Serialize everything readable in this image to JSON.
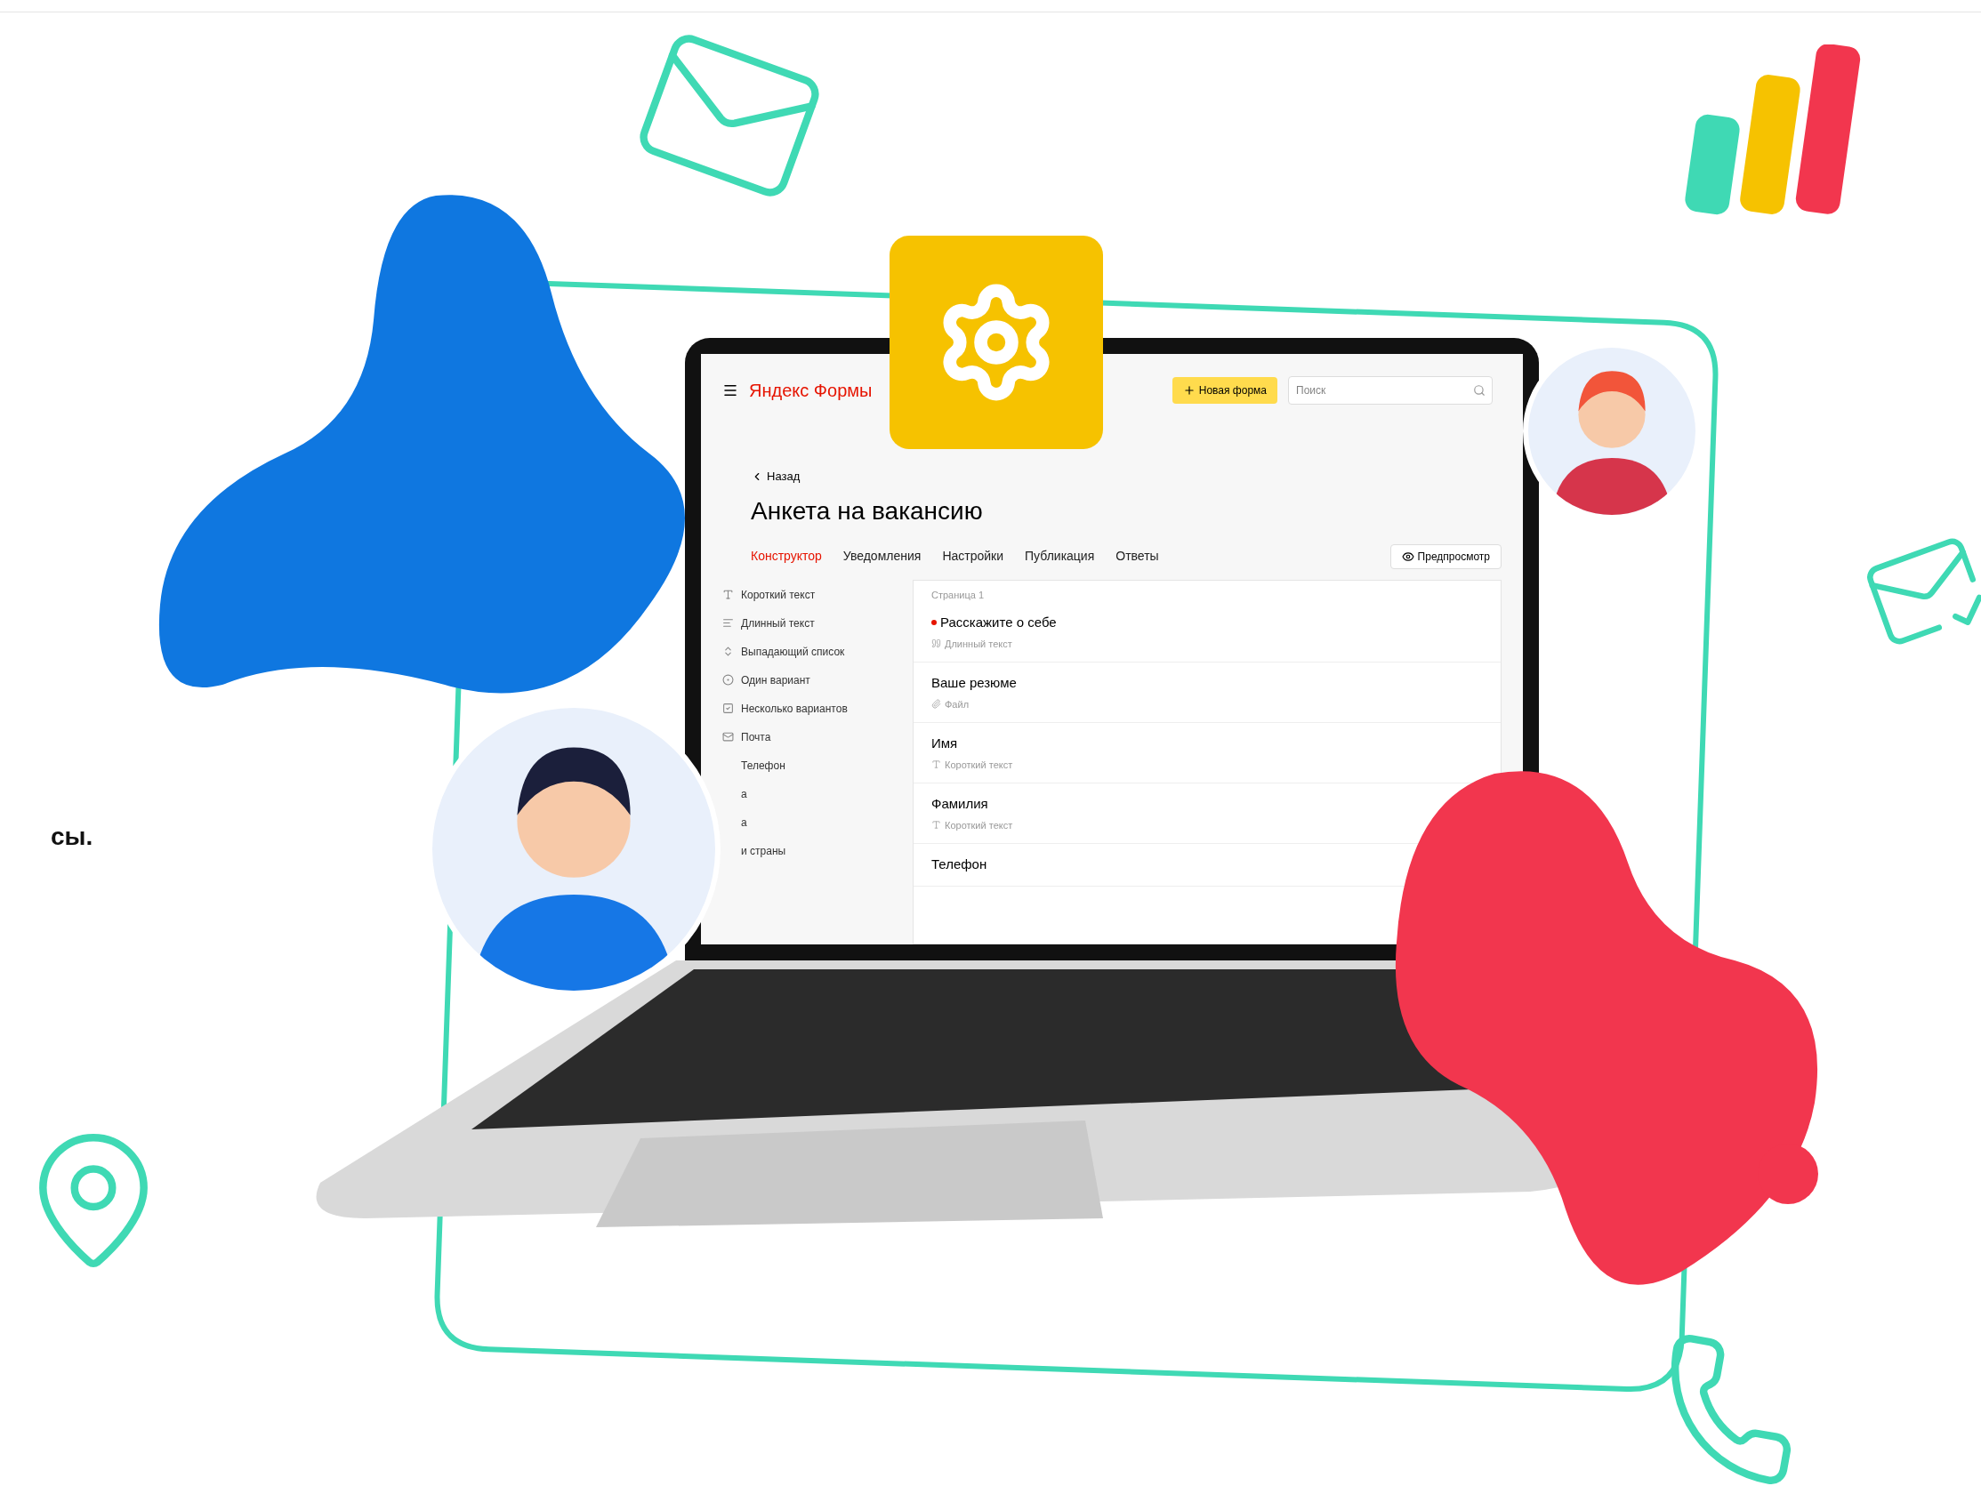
{
  "page": {
    "side_text": "сы."
  },
  "app": {
    "logo": "Яндекс Формы",
    "new_form_button": "Новая форма",
    "search": {
      "placeholder": "Поиск"
    },
    "back_link": "Назад",
    "title": "Анкета на вакансию",
    "tabs": [
      {
        "label": "Конструктор",
        "selected": true
      },
      {
        "label": "Уведомления",
        "selected": false
      },
      {
        "label": "Настройки",
        "selected": false
      },
      {
        "label": "Публикация",
        "selected": false
      },
      {
        "label": "Ответы",
        "selected": false
      }
    ],
    "preview_button": "Предпросмотр",
    "sidebar": {
      "items": [
        {
          "label": "Короткий текст",
          "kind": "short"
        },
        {
          "label": "Длинный текст",
          "kind": "long"
        },
        {
          "label": "Выпадающий список",
          "kind": "select"
        },
        {
          "label": "Один вариант",
          "kind": "radio"
        },
        {
          "label": "Несколько вариантов",
          "kind": "checkbox"
        },
        {
          "label": "Почта",
          "kind": "email"
        },
        {
          "label": "Телефон",
          "kind": "plain"
        },
        {
          "label": "а",
          "kind": "plain"
        },
        {
          "label": "а",
          "kind": "plain"
        },
        {
          "label": "и страны",
          "kind": "plain"
        }
      ]
    },
    "page_label": "Страница 1",
    "questions": [
      {
        "title": "Расскажите о себе",
        "required": true,
        "type_label": "Длинный текст",
        "kind": "long"
      },
      {
        "title": "Ваше резюме",
        "required": false,
        "type_label": "Файл",
        "kind": "file"
      },
      {
        "title": "Имя",
        "required": false,
        "type_label": "Короткий текст",
        "kind": "short"
      },
      {
        "title": "Фамилия",
        "required": false,
        "type_label": "Короткий текст",
        "kind": "short"
      },
      {
        "title": "Телефон",
        "required": false,
        "kind": "plain"
      }
    ]
  }
}
